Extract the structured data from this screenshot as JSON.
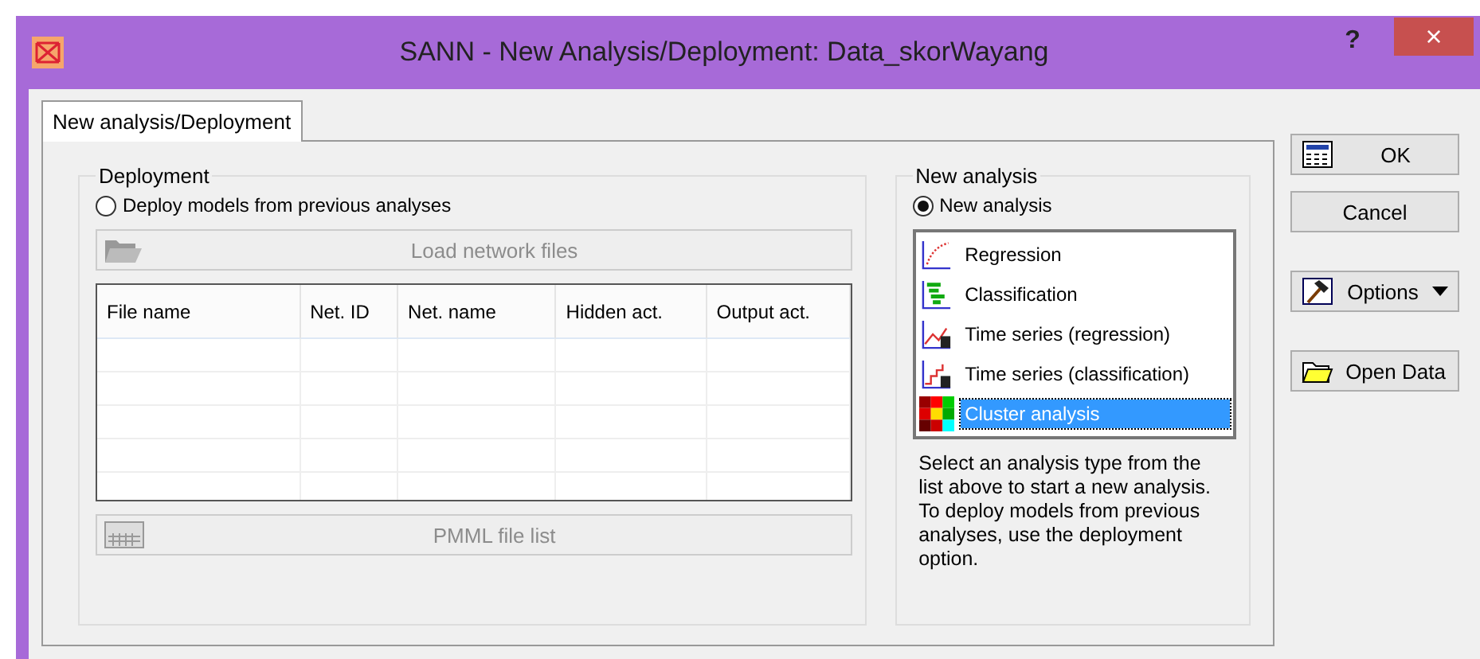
{
  "window": {
    "title": "SANN - New Analysis/Deployment: Data_skorWayang",
    "help": "?",
    "close": "×"
  },
  "tabs": [
    {
      "label": "New analysis/Deployment",
      "selected": true
    }
  ],
  "deployment": {
    "group_label": "Deployment",
    "radio": {
      "label": "Deploy models from previous analyses",
      "selected": false
    },
    "load_button": {
      "label": "Load network files",
      "disabled": true
    },
    "table": {
      "columns": [
        "File name",
        "Net. ID",
        "Net. name",
        "Hidden act.",
        "Output act."
      ]
    },
    "pmml_button": {
      "label": "PMML file list",
      "disabled": true
    }
  },
  "new_analysis": {
    "group_label": "New analysis",
    "radio": {
      "label": "New analysis",
      "selected": true
    },
    "items": [
      {
        "label": "Regression",
        "kind": "regression",
        "selected": false
      },
      {
        "label": "Classification",
        "kind": "classification",
        "selected": false
      },
      {
        "label": "Time series (regression)",
        "kind": "ts-regression",
        "selected": false
      },
      {
        "label": "Time series (classification)",
        "kind": "ts-classification",
        "selected": false
      },
      {
        "label": "Cluster analysis",
        "kind": "cluster",
        "selected": true
      }
    ],
    "hint": "Select an analysis type from the list above to start a new analysis. To deploy models from previous analyses, use the deployment option."
  },
  "buttons": [
    {
      "label": "OK",
      "kind": "ok"
    },
    {
      "label": "Cancel",
      "kind": "plain"
    },
    {
      "label": "Options",
      "kind": "options"
    },
    {
      "label": "Open Data",
      "kind": "open"
    }
  ]
}
